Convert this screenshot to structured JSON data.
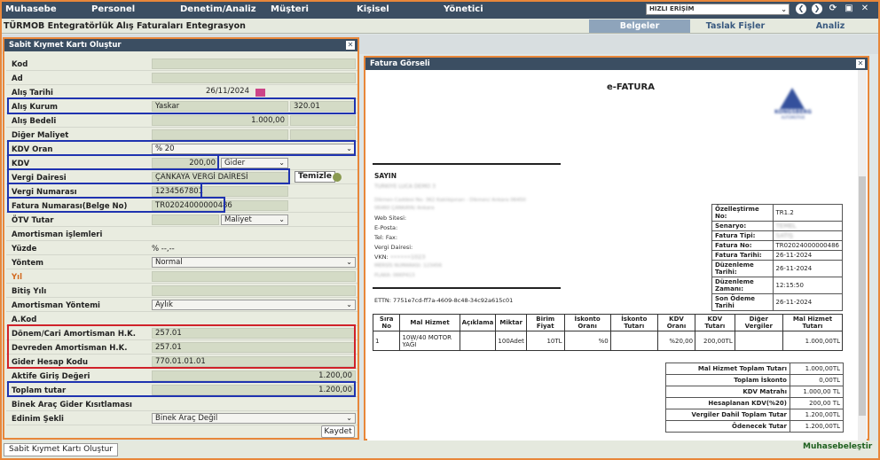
{
  "menu": [
    "Muhasebe",
    "Personel",
    "Denetim/Analiz",
    "Müşteri",
    "Kişisel",
    "Yönetici"
  ],
  "quick_access": "HIZLI ERİŞİM",
  "header_title": "TÜRMOB Entegratörlük Alış Faturaları Entegrasyon",
  "tabs": [
    "Belgeler",
    "Taslak Fişler",
    "Analiz"
  ],
  "left_window": {
    "title": "Sabit Kıymet Kartı Oluştur",
    "labels": {
      "kod": "Kod",
      "ad": "Ad",
      "alis_tarihi": "Alış Tarihi",
      "alis_kurum": "Alış Kurum",
      "alis_bedeli": "Alış Bedeli",
      "diger_maliyet": "Diğer Maliyet",
      "kdv_oran": "KDV Oran",
      "kdv": "KDV",
      "vergi_dairesi": "Vergi Dairesi",
      "vergi_numarasi": "Vergi Numarası",
      "fatura_numarasi": "Fatura Numarası(Belge No)",
      "otv_tutar": "ÖTV Tutar",
      "amortisman_islemleri": "Amortisman işlemleri",
      "yuzde": "Yüzde",
      "yontem": "Yöntem",
      "yil": "Yıl",
      "bitis_yili": "Bitiş Yılı",
      "amortisman_yontemi": "Amortisman Yöntemi",
      "akod": "A.Kod",
      "donem_cari": "Dönem/Cari Amortisman H.K.",
      "devreden": "Devreden Amortisman H.K.",
      "gider_hesap": "Gider Hesap Kodu",
      "aktife_giris": "Aktife Giriş Değeri",
      "toplam_tutar": "Toplam tutar",
      "binek": "Binek Araç Gider Kısıtlaması",
      "edinim": "Edinim Şekli"
    },
    "values": {
      "alis_tarihi": "26/11/2024",
      "alis_kurum_name": "Yaskar",
      "alis_kurum_code": "320.01",
      "alis_bedeli": "1.000,00",
      "kdv_oran": "% 20",
      "kdv": "200,00",
      "kdv_type": "Gider",
      "vergi_dairesi": "ÇANKAYA VERGİ DAİRESİ",
      "temizle": "Temizle",
      "vergi_numarasi": "1234567801",
      "fatura_numarasi": "TR02024000000486",
      "otv_type": "Maliyet",
      "yuzde": "% --,--",
      "yontem": "Normal",
      "amortisman_yontemi": "Aylık",
      "donem_cari": "257.01",
      "devreden": "257.01",
      "gider_hesap": "770.01.01.01",
      "aktife_giris": "1.200,00",
      "toplam_tutar": "1.200,00",
      "edinim": "Binek Araç Değil"
    },
    "save": "Kaydet"
  },
  "right_window": {
    "title": "Fatura Görseli",
    "doc_title": "e-FATURA",
    "logo_text": "KONGSBERG",
    "logo_sub": "AUTOMOTIVE",
    "sayin": "SAYIN",
    "buyer_lines": [
      "TÜRKİYE LUCA DEMO 3",
      "Dikmen Caddesi No: 362 Kaklıkpınarı - Dikmen/ Ankara 06450",
      "06460 ÇANKAYA/ Ankara"
    ],
    "buyer_fields": [
      "Web Sitesi:",
      "E-Posta:",
      "Tel: Fax:",
      "Vergi Dairesi:",
      "VKN:",
      "MERSİS NUMARASI: 123456",
      "PLAKA: 06KP413"
    ],
    "vkn_masked": "••••••1023",
    "ettn": "ETTN: 7751e7cd-ff7a-4609-8c48-34c92a615c01",
    "ozel": [
      [
        "Özelleştirme No:",
        "TR1.2"
      ],
      [
        "Senaryo:",
        "TEMEL"
      ],
      [
        "Fatura Tipi:",
        "SATIŞ"
      ],
      [
        "Fatura No:",
        "TR02024000000486"
      ],
      [
        "Fatura Tarihi:",
        "26-11-2024"
      ],
      [
        "Düzenleme Tarihi:",
        "26-11-2024"
      ],
      [
        "Düzenleme Zamanı:",
        "12:15:50"
      ],
      [
        "Son Ödeme Tarihi",
        "26-11-2024"
      ]
    ],
    "item_headers": [
      "Sıra No",
      "Mal Hizmet",
      "Açıklama",
      "Miktar",
      "Birim Fiyat",
      "İskonto Oranı",
      "İskonto Tutarı",
      "KDV Oranı",
      "KDV Tutarı",
      "Diğer Vergiler",
      "Mal Hizmet Tutarı"
    ],
    "item_row": [
      "1",
      "10W/40 MOTOR YAĞI",
      "",
      "100Adet",
      "10TL",
      "%0",
      "",
      "%20,00",
      "200,00TL",
      "",
      "1.000,00TL"
    ],
    "totals": [
      [
        "Mal Hizmet Toplam Tutarı",
        "1.000,00TL"
      ],
      [
        "Toplam İskonto",
        "0,00TL"
      ],
      [
        "KDV Matrahı",
        "1.000,00 TL"
      ],
      [
        "Hesaplanan KDV(%20)",
        "200,00 TL"
      ],
      [
        "Vergiler Dahil Toplam Tutar",
        "1.200,00TL"
      ],
      [
        "Ödenecek Tutar",
        "1.200,00TL"
      ]
    ]
  },
  "status_left": "Sabit Kıymet Kartı Oluştur",
  "status_right": "Muhasebeleştir"
}
